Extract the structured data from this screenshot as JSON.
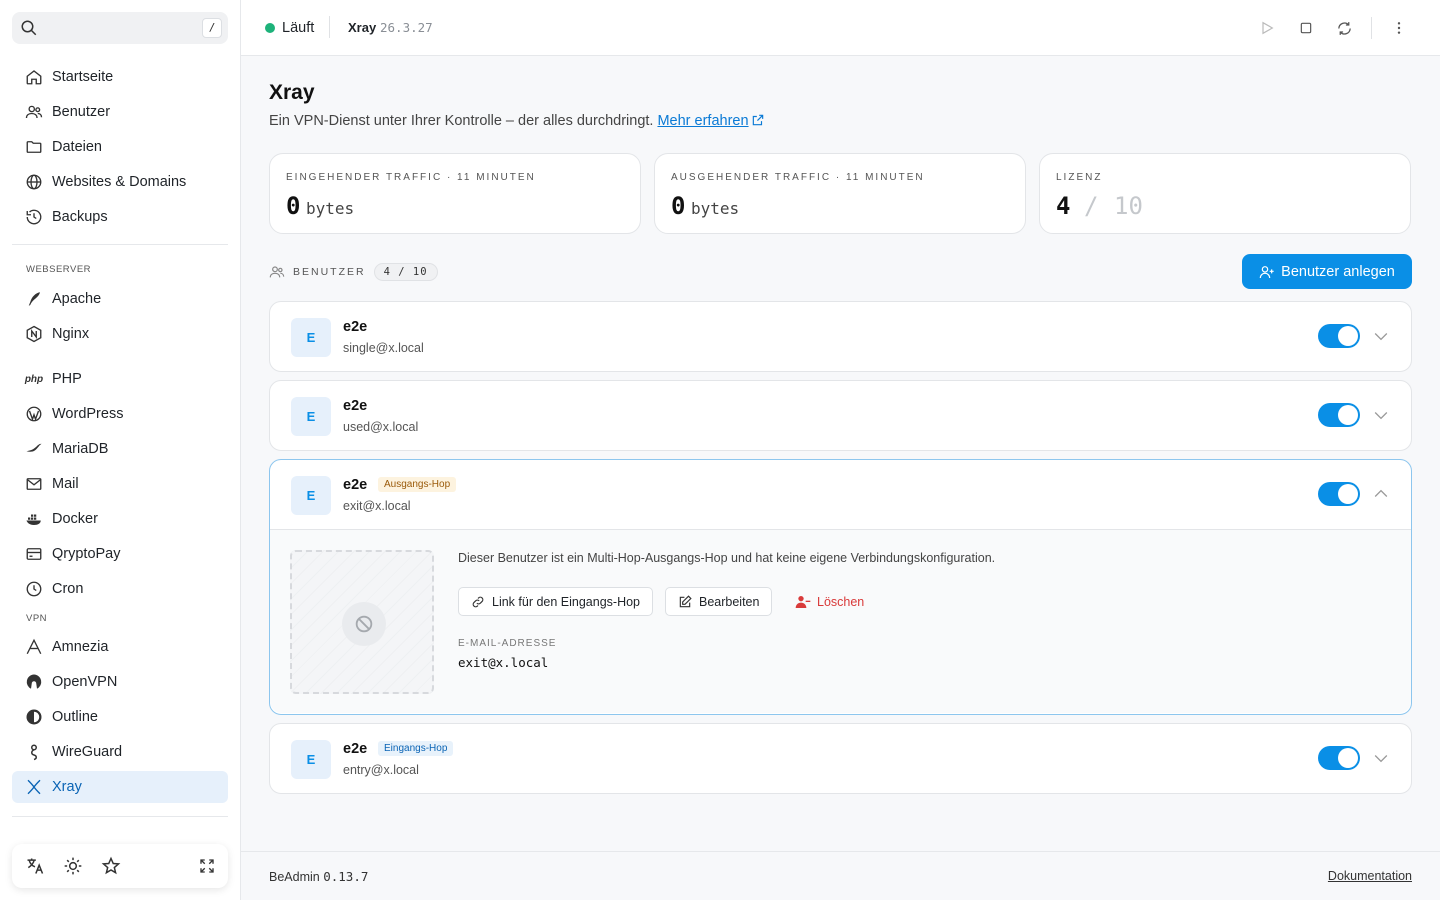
{
  "sidebar": {
    "search_kbd": "/",
    "items": [
      {
        "label": "Startseite",
        "icon": "home-icon"
      },
      {
        "label": "Benutzer",
        "icon": "users-icon"
      },
      {
        "label": "Dateien",
        "icon": "folder-icon"
      },
      {
        "label": "Websites & Domains",
        "icon": "globe-icon"
      },
      {
        "label": "Backups",
        "icon": "history-icon"
      }
    ],
    "webserver_label": "WEBSERVER",
    "webserver_items": [
      {
        "label": "Apache",
        "icon": "feather-icon"
      },
      {
        "label": "Nginx",
        "icon": "nginx-icon"
      }
    ],
    "other_items": [
      {
        "label": "PHP",
        "icon": "php-icon"
      },
      {
        "label": "WordPress",
        "icon": "wordpress-icon"
      },
      {
        "label": "MariaDB",
        "icon": "mariadb-icon"
      },
      {
        "label": "Mail",
        "icon": "mail-icon"
      },
      {
        "label": "Docker",
        "icon": "docker-icon"
      },
      {
        "label": "QryptoPay",
        "icon": "card-icon"
      },
      {
        "label": "Cron",
        "icon": "clock-icon"
      }
    ],
    "vpn_label": "VPN",
    "vpn_items": [
      {
        "label": "Amnezia",
        "icon": "amnezia-icon"
      },
      {
        "label": "OpenVPN",
        "icon": "openvpn-icon"
      },
      {
        "label": "Outline",
        "icon": "outline-icon"
      },
      {
        "label": "WireGuard",
        "icon": "wireguard-icon"
      },
      {
        "label": "Xray",
        "icon": "xray-icon",
        "active": true
      }
    ]
  },
  "topbar": {
    "status": "Läuft",
    "status_color": "#1db27a",
    "app_name": "Xray",
    "app_version": "26.3.27"
  },
  "main": {
    "title": "Xray",
    "subtitle": "Ein VPN-Dienst unter Ihrer Kontrolle – der alles durchdringt.",
    "learn_more": "Mehr erfahren",
    "stats": [
      {
        "label": "EINGEHENDER TRAFFIC · 11 MINUTEN",
        "value": "0",
        "unit": "bytes"
      },
      {
        "label": "AUSGEHENDER TRAFFIC · 11 MINUTEN",
        "value": "0",
        "unit": "bytes"
      },
      {
        "label": "LIZENZ",
        "value": "4",
        "slash": "/",
        "max": "10"
      }
    ],
    "users_label": "BENUTZER",
    "users_count": "4 / 10",
    "add_user": "Benutzer anlegen",
    "users": [
      {
        "initial": "E",
        "name": "e2e",
        "email": "single@x.local",
        "enabled": true
      },
      {
        "initial": "E",
        "name": "e2e",
        "email": "used@x.local",
        "enabled": true
      },
      {
        "initial": "E",
        "name": "e2e",
        "email": "exit@x.local",
        "badge": "Ausgangs-Hop",
        "enabled": true,
        "expanded": true
      },
      {
        "initial": "E",
        "name": "e2e",
        "email": "entry@x.local",
        "badge": "Eingangs-Hop",
        "enabled": true
      }
    ],
    "expanded": {
      "info": "Dieser Benutzer ist ein Multi-Hop-Ausgangs-Hop und hat keine eigene Verbindungskonfiguration.",
      "link_btn": "Link für den Eingangs-Hop",
      "edit_btn": "Bearbeiten",
      "delete_btn": "Löschen",
      "email_label": "E-MAIL-ADRESSE",
      "email_value": "exit@x.local"
    }
  },
  "footer": {
    "app": "BeAdmin",
    "version": "0.13.7",
    "docs": "Dokumentation"
  },
  "colors": {
    "accent": "#0a8fe6",
    "danger": "#d93a3a",
    "exit_badge": "#9a5a0a",
    "entry_badge": "#0a64b5"
  }
}
